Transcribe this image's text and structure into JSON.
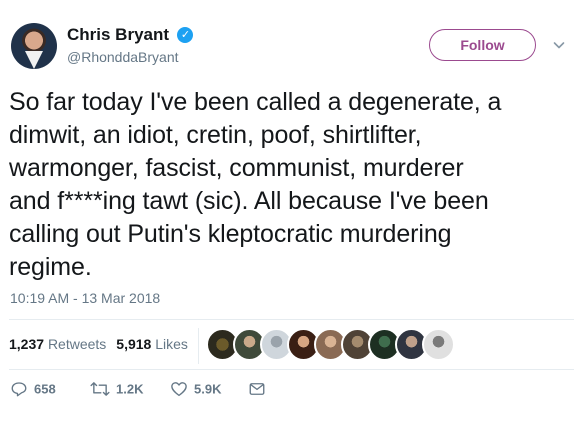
{
  "author": {
    "name": "Chris Bryant",
    "handle": "@RhonddaBryant",
    "verified_mark": "✓"
  },
  "follow_label": "Follow",
  "tweet": {
    "text": "So far today I've been called a degenerate, a\ndimwit, an idiot, cretin, poof, shirtlifter,\nwarmonger, fascist, communist, murderer\nand f****ing tawt (sic). All because I've been\ncalling out Putin's kleptocratic murdering\nregime.",
    "timestamp": "10:19 AM - 13 Mar 2018"
  },
  "stats": {
    "retweets_count": "1,237",
    "retweets_label": "Retweets",
    "likes_count": "5,918",
    "likes_label": "Likes"
  },
  "actions": {
    "replies": "658",
    "retweets": "1.2K",
    "likes": "5.9K"
  },
  "colors": {
    "accent": "#9b4a8f",
    "muted": "#657786",
    "text": "#14171a",
    "verified": "#1da1f2"
  }
}
